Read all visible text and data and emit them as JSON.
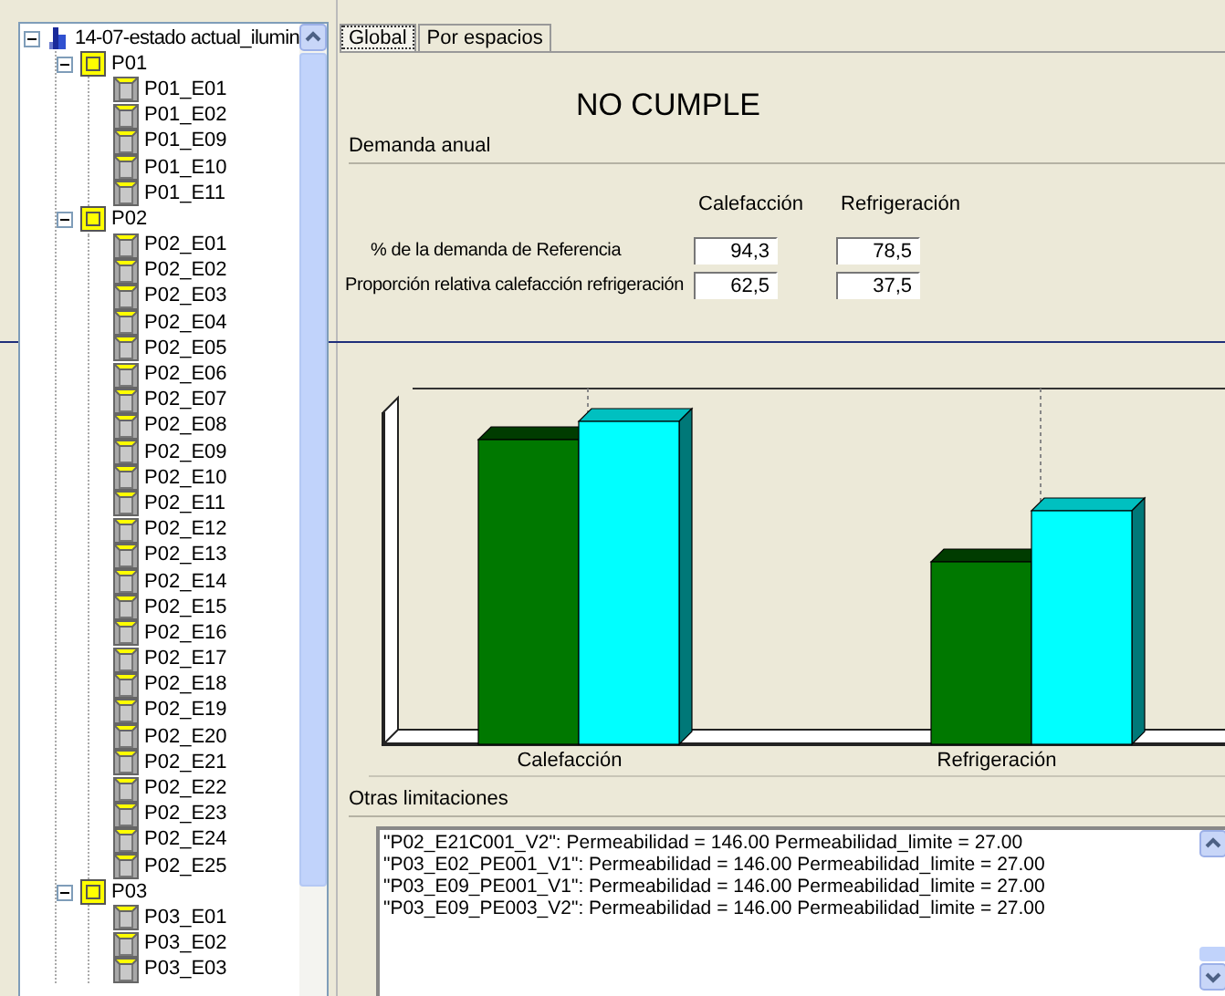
{
  "tree": {
    "label": "14-07-estado actual_ilumin",
    "kind": "building",
    "expanded": true,
    "children": [
      {
        "label": "P01",
        "kind": "floor",
        "expanded": true,
        "children": [
          {
            "label": "P01_E01",
            "kind": "space"
          },
          {
            "label": "P01_E02",
            "kind": "space"
          },
          {
            "label": "P01_E09",
            "kind": "space"
          },
          {
            "label": "P01_E10",
            "kind": "space"
          },
          {
            "label": "P01_E11",
            "kind": "space"
          }
        ]
      },
      {
        "label": "P02",
        "kind": "floor",
        "expanded": true,
        "children": [
          {
            "label": "P02_E01",
            "kind": "space"
          },
          {
            "label": "P02_E02",
            "kind": "space"
          },
          {
            "label": "P02_E03",
            "kind": "space"
          },
          {
            "label": "P02_E04",
            "kind": "space"
          },
          {
            "label": "P02_E05",
            "kind": "space"
          },
          {
            "label": "P02_E06",
            "kind": "space"
          },
          {
            "label": "P02_E07",
            "kind": "space"
          },
          {
            "label": "P02_E08",
            "kind": "space"
          },
          {
            "label": "P02_E09",
            "kind": "space"
          },
          {
            "label": "P02_E10",
            "kind": "space"
          },
          {
            "label": "P02_E11",
            "kind": "space"
          },
          {
            "label": "P02_E12",
            "kind": "space"
          },
          {
            "label": "P02_E13",
            "kind": "space"
          },
          {
            "label": "P02_E14",
            "kind": "space"
          },
          {
            "label": "P02_E15",
            "kind": "space"
          },
          {
            "label": "P02_E16",
            "kind": "space"
          },
          {
            "label": "P02_E17",
            "kind": "space"
          },
          {
            "label": "P02_E18",
            "kind": "space"
          },
          {
            "label": "P02_E19",
            "kind": "space"
          },
          {
            "label": "P02_E20",
            "kind": "space"
          },
          {
            "label": "P02_E21",
            "kind": "space"
          },
          {
            "label": "P02_E22",
            "kind": "space"
          },
          {
            "label": "P02_E23",
            "kind": "space"
          },
          {
            "label": "P02_E24",
            "kind": "space"
          },
          {
            "label": "P02_E25",
            "kind": "space"
          }
        ]
      },
      {
        "label": "P03",
        "kind": "floor",
        "expanded": true,
        "children": [
          {
            "label": "P03_E01",
            "kind": "space"
          },
          {
            "label": "P03_E02",
            "kind": "space"
          },
          {
            "label": "P03_E03",
            "kind": "space"
          }
        ]
      }
    ]
  },
  "tabs": [
    {
      "label": "Global",
      "selected": true
    },
    {
      "label": "Por espacios",
      "selected": false
    }
  ],
  "verdict": "NO CUMPLE",
  "demand": {
    "title": "Demanda anual",
    "columns": [
      "Calefacción",
      "Refrigeración"
    ],
    "rows": [
      {
        "label": "% de la demanda de Referencia",
        "values": [
          "94,3",
          "78,5"
        ]
      },
      {
        "label": "Proporción relativa calefacción refrigeración",
        "values": [
          "62,5",
          "37,5"
        ]
      }
    ]
  },
  "chart": {
    "categories": [
      "Calefacción",
      "Refrigeración"
    ]
  },
  "limits": {
    "title": "Otras limitaciones",
    "lines": [
      "\"P02_E21C001_V2\": Permeabilidad = 146.00 Permeabilidad_limite = 27.00",
      "\"P03_E02_PE001_V1\": Permeabilidad = 146.00 Permeabilidad_limite = 27.00",
      "\"P03_E09_PE001_V1\": Permeabilidad = 146.00 Permeabilidad_limite = 27.00",
      "\"P03_E09_PE003_V2\": Permeabilidad = 146.00 Permeabilidad_limite = 27.00"
    ]
  }
}
